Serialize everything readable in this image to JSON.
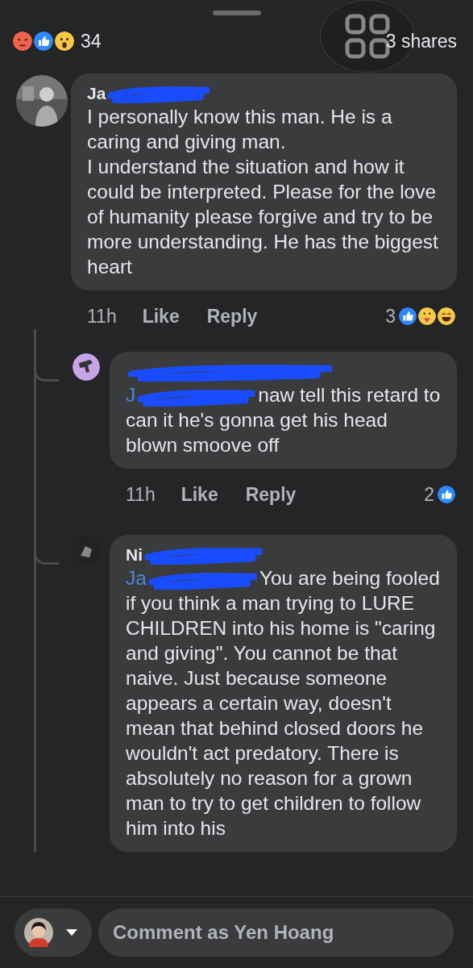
{
  "header": {
    "reactions": [
      {
        "kind": "angry"
      },
      {
        "kind": "like"
      },
      {
        "kind": "wow"
      }
    ],
    "reaction_count": "34",
    "shares": "3 shares"
  },
  "comments": [
    {
      "author": "Ja",
      "author_redacted": true,
      "text": "I personally know this man. He is a caring and giving man.\nI understand the situation and how it could be interpreted. Please for the love of humanity please forgive and try to be more understanding. He has the biggest heart",
      "time": "11h",
      "like": "Like",
      "reply": "Reply",
      "reaction_count": "3",
      "reactions": [
        {
          "kind": "like"
        },
        {
          "kind": "care"
        },
        {
          "kind": "haha"
        }
      ],
      "children": [
        {
          "author_redacted": true,
          "mention": "J",
          "text": "naw tell this retard to can it he's gonna get his head blown smoove off",
          "time": "11h",
          "like": "Like",
          "reply": "Reply",
          "reaction_count": "2",
          "reactions": [
            {
              "kind": "like"
            }
          ]
        },
        {
          "author": "Ni",
          "author_redacted": true,
          "mention": "Ja",
          "text": "You are being fooled if you think a man trying to LURE CHILDREN into his home is \"caring and giving\". You cannot be that naive. Just because someone appears a certain way, doesn't mean that behind closed doors he wouldn't act predatory. There is absolutely no reason for a grown man to try to get children to follow him into his"
        }
      ]
    }
  ],
  "composer": {
    "placeholder": "Comment as Yen Hoang"
  }
}
